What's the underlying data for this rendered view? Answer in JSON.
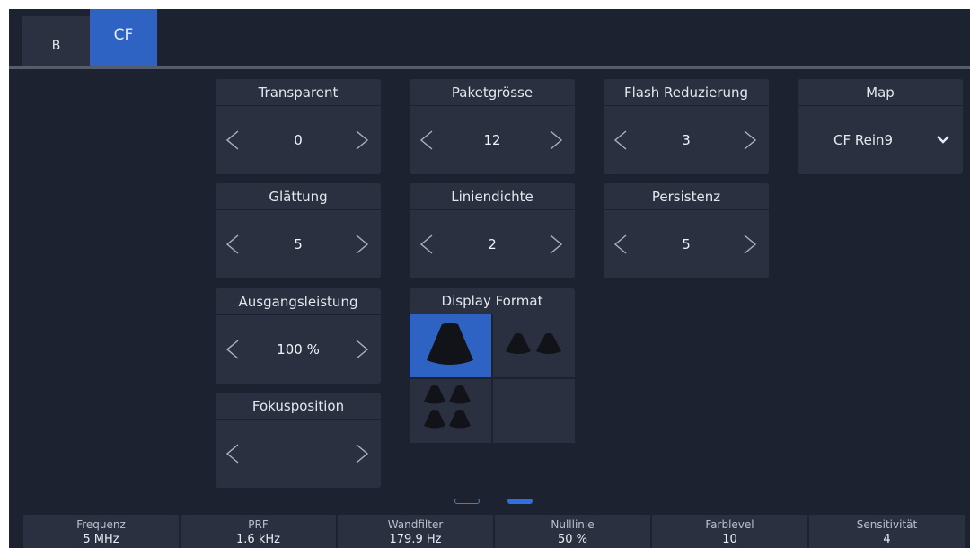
{
  "tabs": [
    {
      "label": "B",
      "active": false
    },
    {
      "label": "CF",
      "active": true
    }
  ],
  "controls": {
    "transparent": {
      "label": "Transparent",
      "value": "0"
    },
    "paketgroesse": {
      "label": "Paketgrösse",
      "value": "12"
    },
    "flash": {
      "label": "Flash Reduzierung",
      "value": "3"
    },
    "map": {
      "label": "Map",
      "value": "CF Rein9"
    },
    "glaettung": {
      "label": "Glättung",
      "value": "5"
    },
    "liniendichte": {
      "label": "Liniendichte",
      "value": "2"
    },
    "persistenz": {
      "label": "Persistenz",
      "value": "5"
    },
    "ausgang": {
      "label": "Ausgangsleistung",
      "value": "100 %"
    },
    "fokus": {
      "label": "Fokusposition",
      "value": ""
    }
  },
  "display_format": {
    "label": "Display Format",
    "selected_index": 0
  },
  "pagination": {
    "pages": 2,
    "current": 2
  },
  "bottom_bar": [
    {
      "label": "Frequenz",
      "value": "5 MHz"
    },
    {
      "label": "PRF",
      "value": "1.6 kHz"
    },
    {
      "label": "Wandfilter",
      "value": "179.9 Hz"
    },
    {
      "label": "Nulllinie",
      "value": "50 %"
    },
    {
      "label": "Farblevel",
      "value": "10"
    },
    {
      "label": "Sensitivität",
      "value": "4"
    }
  ],
  "colors": {
    "accent": "#2f63c3",
    "background": "#1c2230",
    "card": "#2a3040"
  }
}
